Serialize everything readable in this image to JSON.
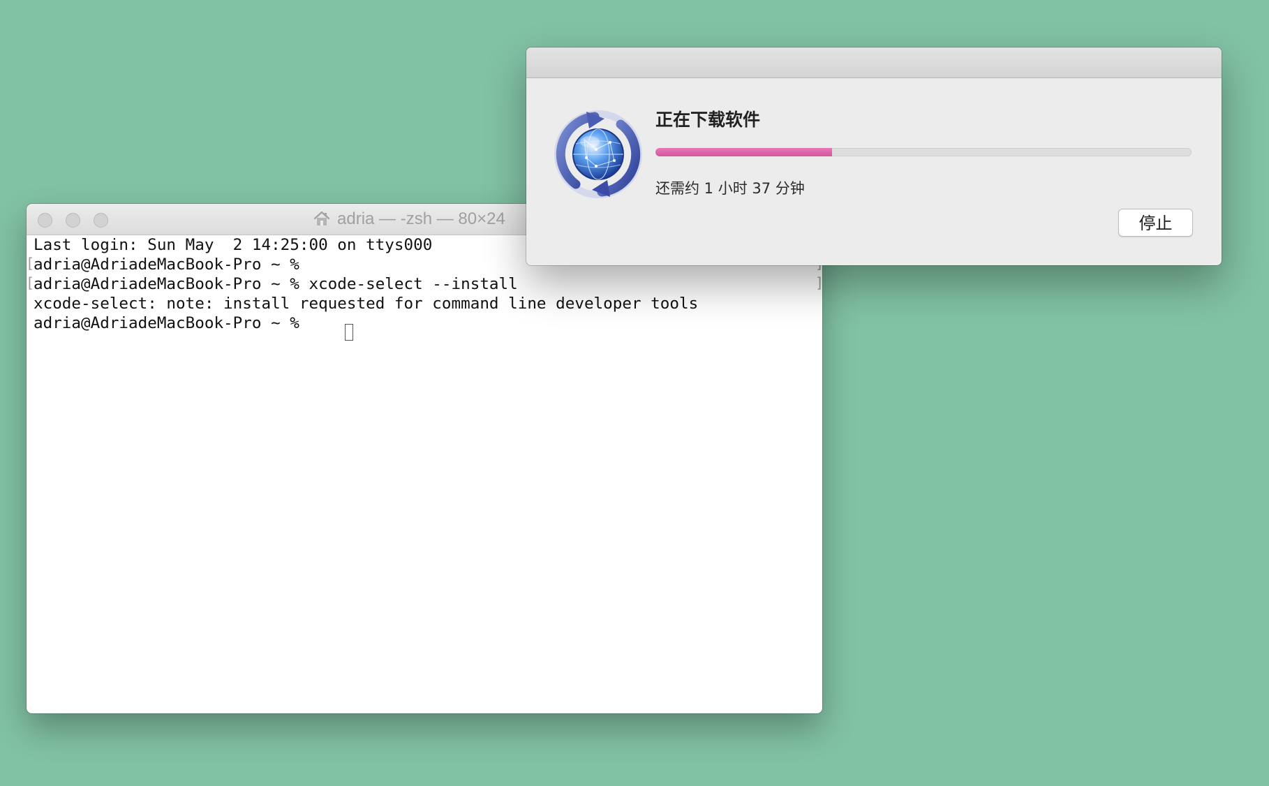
{
  "colors": {
    "desktop_background": "#82c2a4",
    "progress_fill": "#d85ea3",
    "terminal_background": "#ffffff",
    "dialog_background": "#ececec"
  },
  "terminal": {
    "title": "adria — -zsh — 80×24",
    "title_icon": "home-icon",
    "lines": [
      "Last login: Sun May  2 14:25:00 on ttys000",
      "adria@AdriadeMacBook-Pro ~ %",
      "adria@AdriadeMacBook-Pro ~ % xcode-select --install",
      "xcode-select: note: install requested for command line developer tools",
      "adria@AdriadeMacBook-Pro ~ %"
    ]
  },
  "dialog": {
    "icon": "software-update-globe-icon",
    "title": "正在下载软件",
    "progress_fraction": 0.33,
    "status": "还需约 1 小时 37 分钟",
    "stop_label": "停止"
  }
}
